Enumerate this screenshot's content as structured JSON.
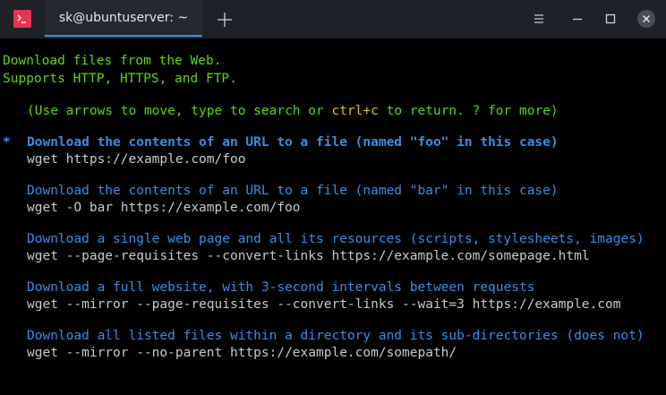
{
  "window": {
    "tab_title": "sk@ubuntuserver: ~"
  },
  "intro": {
    "line1": "Download files from the Web.",
    "line2": "Supports HTTP, HTTPS, and FTP."
  },
  "help": {
    "prefix": "(Use arrows to move, type to search or ",
    "key": "ctrl+c",
    "suffix": " to return. ? for more)"
  },
  "selection_marker": "*",
  "examples": [
    {
      "description": "Download the contents of an URL to a file (named \"foo\" in this case)",
      "command": "wget https://example.com/foo",
      "selected": true
    },
    {
      "description": "Download the contents of an URL to a file (named \"bar\" in this case)",
      "command": "wget -O bar https://example.com/foo",
      "selected": false
    },
    {
      "description": "Download a single web page and all its resources (scripts, stylesheets, images)",
      "command": "wget --page-requisites --convert-links https://example.com/somepage.html",
      "selected": false
    },
    {
      "description": "Download a full website, with 3-second intervals between requests",
      "command": "wget --mirror --page-requisites --convert-links --wait=3 https://example.com",
      "selected": false
    },
    {
      "description": "Download all listed files within a directory and its sub-directories (does not)",
      "command": "wget --mirror --no-parent https://example.com/somepath/",
      "selected": false
    }
  ],
  "colors": {
    "intro": "#5fd700",
    "highlight_key": "#e5c100",
    "description": "#3a8ee6",
    "command": "#c9c9c9",
    "titlebar": "#1e2125",
    "accent": "#3d8fe0",
    "app_icon": "#e8344e"
  },
  "icons": {
    "app": "terminal-icon",
    "new_tab": "plus-icon",
    "menu": "hamburger-icon",
    "minimize": "minimize-icon",
    "maximize": "maximize-icon",
    "close": "close-icon"
  }
}
